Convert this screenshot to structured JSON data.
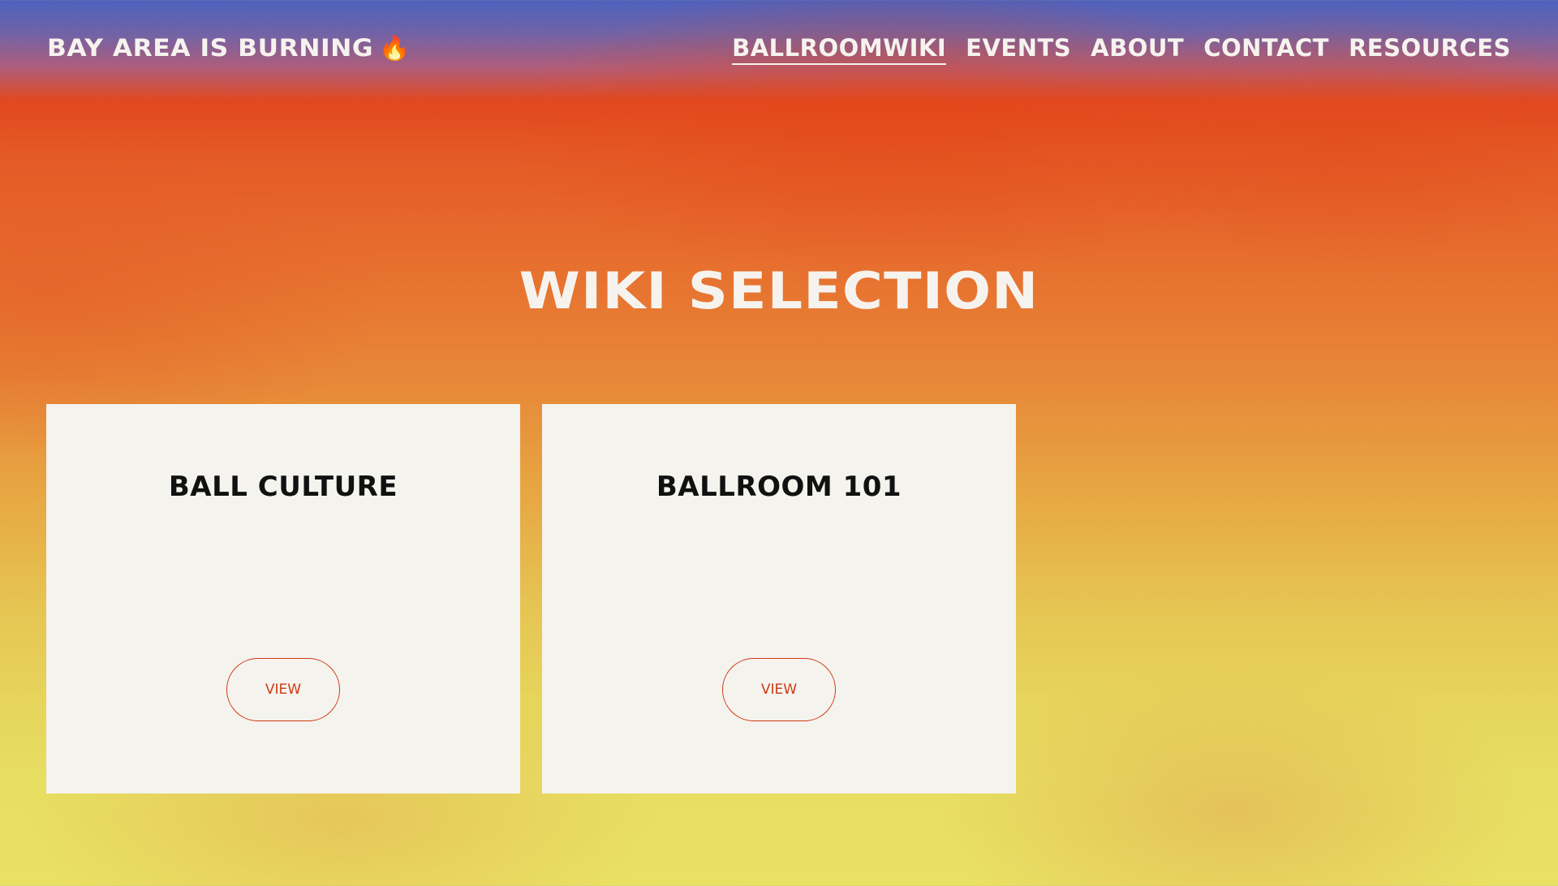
{
  "nav": {
    "brand": "BAY AREA IS BURNING",
    "brand_icon": "🔥",
    "items": [
      {
        "label": "BALLROOMWIKI",
        "active": true
      },
      {
        "label": "EVENTS",
        "active": false
      },
      {
        "label": "ABOUT",
        "active": false
      },
      {
        "label": "CONTACT",
        "active": false
      },
      {
        "label": "RESOURCES",
        "active": false
      }
    ]
  },
  "main": {
    "title": "WIKI SELECTION",
    "cards": [
      {
        "title": "BALL CULTURE",
        "button_label": "VIEW"
      },
      {
        "title": "BALLROOM 101",
        "button_label": "VIEW"
      }
    ]
  },
  "colors": {
    "accent": "#cf3a14",
    "card_bg": "#f5f3ee",
    "text_light": "#f6f3ee"
  }
}
